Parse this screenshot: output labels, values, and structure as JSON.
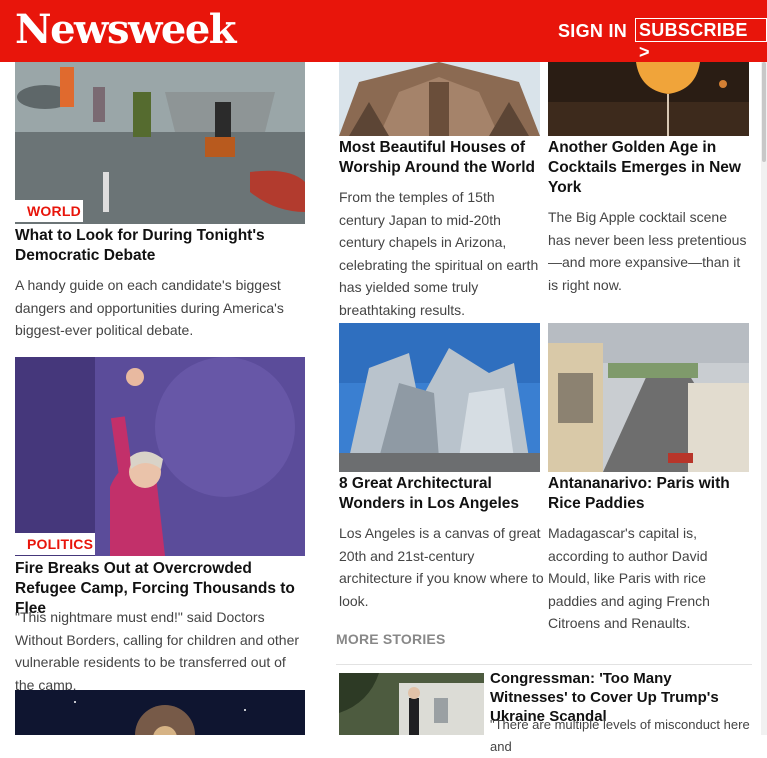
{
  "header": {
    "logo": "Newsweek",
    "signin": "SIGN IN",
    "subscribe": "SUBSCRIBE >"
  },
  "left_articles": [
    {
      "tag": "WORLD",
      "title": "What to Look for During Tonight's Democratic Debate",
      "summary": "A handy guide on each candidate's biggest dangers and opportunities during America's biggest-ever political debate."
    },
    {
      "tag": "POLITICS",
      "title": "Fire Breaks Out at Overcrowded Refugee Camp, Forcing Thousands to Flee",
      "summary": "\"This nightmare must end!\" said Doctors Without Borders, calling for children and other vulnerable residents to be transferred out of the camp."
    }
  ],
  "grid_articles": [
    {
      "title": "Most Beautiful Houses of Worship Around the World",
      "summary": "From the temples of 15th century Japan to mid-20th century chapels in Arizona, celebrating the spiritual on earth has yielded some truly breathtaking results."
    },
    {
      "title": "Another Golden Age in Cocktails Emerges in New York",
      "summary": "The Big Apple cocktail scene has never been less pretentious—and more expansive—than it is right now."
    },
    {
      "title": "8 Great Architectural Wonders in Los Angeles",
      "summary": "Los Angeles is a canvas of great 20th and 21st-century architecture if you know where to look."
    },
    {
      "title": "Antananarivo: Paris with Rice Paddies",
      "summary": "Madagascar's capital is, according to author David Mould, like Paris with rice paddies and aging French Citroens and Renaults."
    }
  ],
  "more_stories": {
    "label": "MORE STORIES",
    "items": [
      {
        "title": "Congressman: 'Too Many Witnesses' to Cover Up Trump's Ukraine Scandal",
        "summary": "\"There are multiple levels of misconduct here and"
      }
    ]
  },
  "colors": {
    "brand": "#e8150b",
    "tag": "#e8150b"
  }
}
